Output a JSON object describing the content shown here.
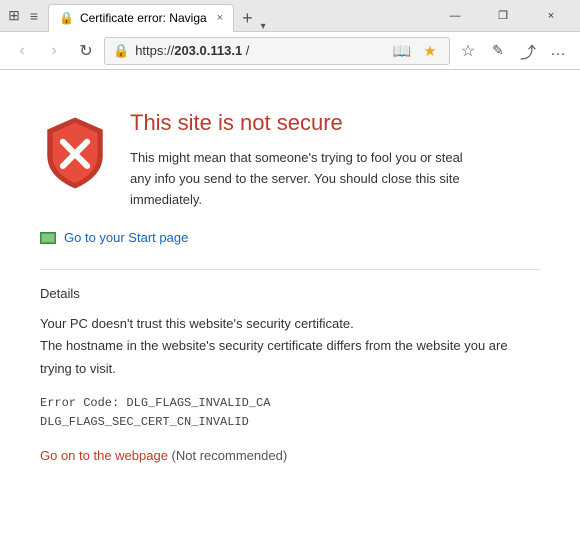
{
  "titlebar": {
    "tab_title": "Certificate error: Naviga",
    "close_label": "×",
    "minimize_label": "—",
    "restore_label": "❐",
    "new_tab_label": "+",
    "tab_chevron": "›"
  },
  "addressbar": {
    "url_prefix": "https://",
    "url_domain": "203.0.113.1",
    "url_suffix": " /",
    "back_label": "‹",
    "forward_label": "›",
    "refresh_label": "↻",
    "reading_mode_label": "📖",
    "favorites_label": "☆",
    "hub_label": "☆",
    "notes_label": "✏",
    "share_label": "⤴",
    "more_label": "…"
  },
  "error_page": {
    "title": "This site is not secure",
    "description": "This might mean that someone's trying to fool you or steal any info you send to the server. You should close this site immediately.",
    "start_page_label": "Go to your Start page",
    "details_label": "Details",
    "details_text_line1": "Your PC doesn't trust this website's security certificate.",
    "details_text_line2": "The hostname in the website's security certificate differs from the website you are trying to visit.",
    "error_code_line1": "Error Code:  DLG_FLAGS_INVALID_CA",
    "error_code_line2": "DLG_FLAGS_SEC_CERT_CN_INVALID",
    "go_on_link": "Go on to the webpage",
    "go_on_note": " (Not recommended)"
  },
  "colors": {
    "error_title": "#c0392b",
    "link_blue": "#1565C0",
    "link_red": "#c0392b"
  }
}
